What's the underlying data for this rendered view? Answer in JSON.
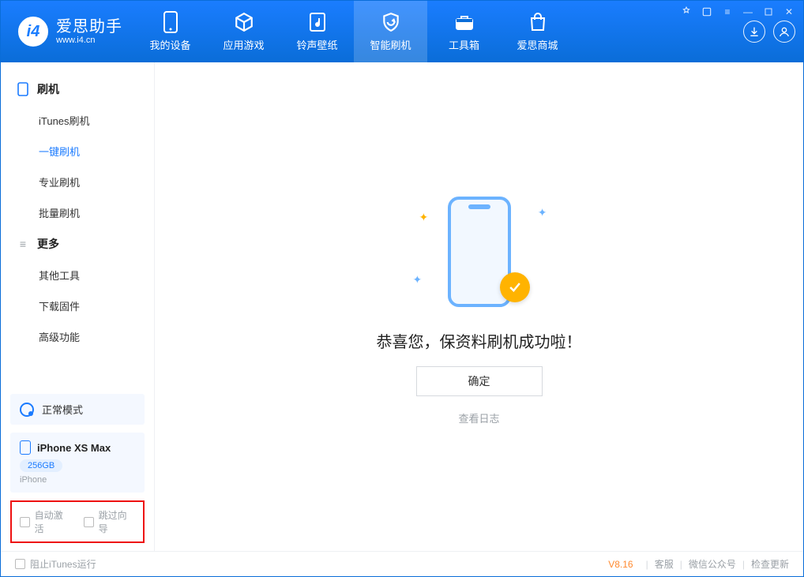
{
  "app": {
    "name": "爱思助手",
    "url": "www.i4.cn"
  },
  "nav": {
    "tabs": [
      {
        "label": "我的设备"
      },
      {
        "label": "应用游戏"
      },
      {
        "label": "铃声壁纸"
      },
      {
        "label": "智能刷机"
      },
      {
        "label": "工具箱"
      },
      {
        "label": "爱思商城"
      }
    ]
  },
  "sidebar": {
    "group1": {
      "title": "刷机",
      "items": [
        "iTunes刷机",
        "一键刷机",
        "专业刷机",
        "批量刷机"
      ]
    },
    "group2": {
      "title": "更多",
      "items": [
        "其他工具",
        "下载固件",
        "高级功能"
      ]
    },
    "mode": "正常模式",
    "device": {
      "name": "iPhone XS Max",
      "capacity": "256GB",
      "type": "iPhone"
    },
    "opts": {
      "auto_activate": "自动激活",
      "skip_guide": "跳过向导"
    }
  },
  "main": {
    "success_msg": "恭喜您，保资料刷机成功啦！",
    "ok_btn": "确定",
    "log_link": "查看日志"
  },
  "footer": {
    "block_itunes": "阻止iTunes运行",
    "version": "V8.16",
    "links": [
      "客服",
      "微信公众号",
      "检查更新"
    ]
  }
}
